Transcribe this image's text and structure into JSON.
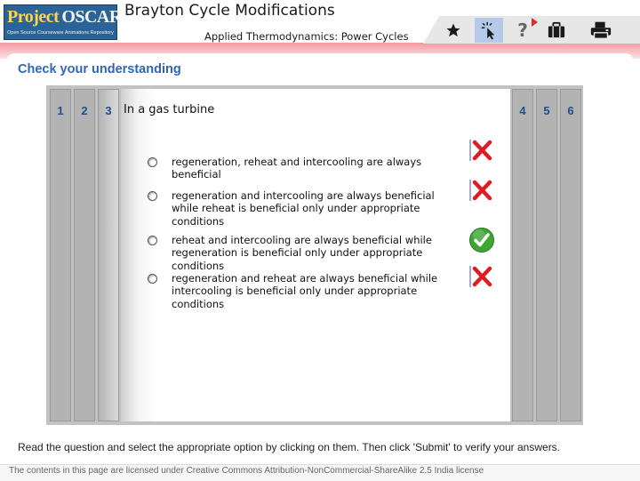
{
  "header": {
    "logo": {
      "word1": "Project",
      "word2": "OSCAR",
      "tagline": "Open Source Courseware Animations Repository"
    },
    "title": "Brayton Cycle Modifications",
    "subtitle": "Applied Thermodynamics: Power Cycles",
    "toolbar": {
      "help_label": "?"
    },
    "icons": [
      "star-icon",
      "cursor-icon",
      "help-icon",
      "briefcase-icon",
      "print-icon"
    ]
  },
  "section_heading": "Check your understanding",
  "tabs": [
    "1",
    "2",
    "3",
    "4",
    "5",
    "6"
  ],
  "question": "In a gas turbine",
  "options": [
    {
      "text": "regeneration, reheat and intercooling are always beneficial",
      "result": "wrong"
    },
    {
      "text": "regeneration and intercooling are always beneficial while reheat is beneficial only under appropriate conditions",
      "result": "wrong"
    },
    {
      "text": "reheat and intercooling are always beneficial while regeneration is beneficial only under appropriate conditions",
      "result": "correct"
    },
    {
      "text": "regeneration and reheat are always beneficial while intercooling is beneficial only under appropriate conditions",
      "result": "wrong"
    }
  ],
  "instruction": "Read the question and select the appropriate option by clicking on them. Then click 'Submit' to verify your answers.",
  "license": "The contents in this page are licensed under Creative Commons Attribution-NonCommercial-ShareAlike 2.5 India license",
  "colors": {
    "heading_blue": "#2f66b2",
    "tab_number_blue": "#1e4f8f",
    "wrong_red": "#e01b24",
    "correct_green": "#3fa535",
    "header_pink": "#f29aa0"
  }
}
